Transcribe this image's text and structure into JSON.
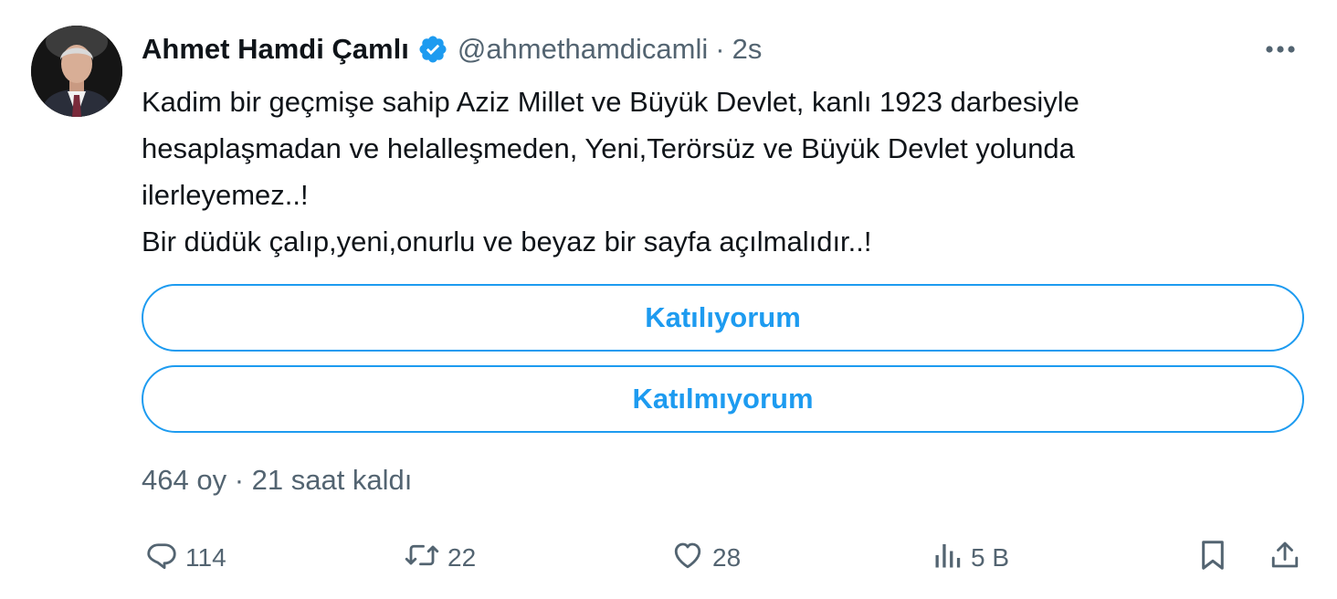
{
  "author": {
    "display_name": "Ahmet Hamdi Çamlı",
    "handle": "@ahmethamdicamli",
    "separator": "·",
    "time": "2s",
    "verified": true,
    "verified_color": "#1d9bf0"
  },
  "tweet": {
    "lines": [
      "Kadim bir geçmişe sahip Aziz Millet  ve Büyük Devlet, kanlı 1923 darbesiyle",
      "hesaplaşmadan ve helalleşmeden, Yeni,Terörsüz ve Büyük Devlet yolunda",
      "ilerleyemez..!",
      "Bir düdük çalıp,yeni,onurlu ve beyaz bir sayfa açılmalıdır..!"
    ]
  },
  "poll": {
    "options": [
      {
        "label": "Katılıyorum"
      },
      {
        "label": "Katılmıyorum"
      }
    ],
    "meta": "464 oy · 21 saat kaldı",
    "accent_color": "#1d9bf0"
  },
  "actions": {
    "reply": {
      "icon": "reply-icon",
      "count": "114"
    },
    "retweet": {
      "icon": "retweet-icon",
      "count": "22"
    },
    "like": {
      "icon": "heart-icon",
      "count": "28"
    },
    "views": {
      "icon": "views-icon",
      "count": "5 B"
    },
    "bookmark": {
      "icon": "bookmark-icon"
    },
    "share": {
      "icon": "share-icon"
    }
  },
  "colors": {
    "text_primary": "#0f1419",
    "text_secondary": "#536471"
  }
}
